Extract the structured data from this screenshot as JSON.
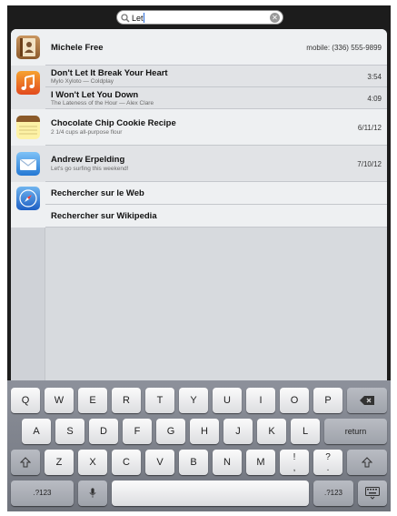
{
  "search": {
    "value": "Let",
    "clear_icon": "clear-icon"
  },
  "results": {
    "contacts": {
      "name": "Michele Free",
      "detail": "mobile: (336) 555-9899"
    },
    "music": [
      {
        "title": "Don't Let It Break Your Heart",
        "subtitle": "Mylo Xyloto — Coldplay",
        "duration": "3:54"
      },
      {
        "title": "I Won't Let You Down",
        "subtitle": "The Lateness of the Hour — Alex Clare",
        "duration": "4:09"
      }
    ],
    "notes": {
      "title": "Chocolate Chip Cookie Recipe",
      "subtitle": "2 1/4 cups all-purpose flour",
      "date": "6/11/12"
    },
    "mail": {
      "title": "Andrew Erpelding",
      "subtitle": "Let's go surfing this weekend!",
      "date": "7/10/12"
    },
    "web": [
      {
        "label": "Rechercher sur le Web"
      },
      {
        "label": "Rechercher sur Wikipedia"
      }
    ]
  },
  "keyboard": {
    "row1": [
      "Q",
      "W",
      "E",
      "R",
      "T",
      "Y",
      "U",
      "I",
      "O",
      "P"
    ],
    "row2": [
      "A",
      "S",
      "D",
      "F",
      "G",
      "H",
      "J",
      "K",
      "L"
    ],
    "row3": [
      "Z",
      "X",
      "C",
      "V",
      "B",
      "N",
      "M"
    ],
    "punct1": [
      "!",
      ","
    ],
    "punct2": [
      "?",
      "."
    ],
    "return_label": "return",
    "numbers_label": ".?123",
    "icons": [
      "backspace-icon",
      "shift-icon",
      "microphone-icon",
      "keyboard-hide-icon"
    ]
  }
}
